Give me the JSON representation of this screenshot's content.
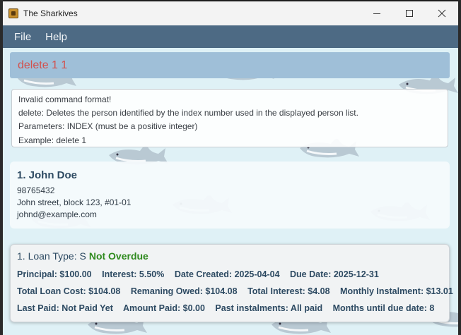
{
  "window": {
    "title": "The Sharkives"
  },
  "menu": {
    "items": [
      "File",
      "Help"
    ]
  },
  "command": {
    "text": "delete 1 1"
  },
  "result": {
    "lines": [
      "Invalid command format!",
      "delete: Deletes the person identified by the index number used in the displayed person list.",
      "Parameters: INDEX (must be a positive integer)",
      "Example: delete 1"
    ]
  },
  "person": {
    "index_name": "1.  John Doe",
    "phone": "98765432",
    "address": "John street, block 123, #01-01",
    "email": "johnd@example.com"
  },
  "loan": {
    "title": "1. Loan Type: S",
    "status": "Not Overdue",
    "row1": [
      "Principal: $100.00",
      "Interest: 5.50%",
      "Date Created: 2025-04-04",
      "Due Date: 2025-12-31"
    ],
    "row2": [
      "Total Loan Cost: $104.08",
      "Remaning Owed: $104.08",
      "Total Interest: $4.08",
      "Monthly Instalment: $13.01"
    ],
    "row3": [
      "Last Paid: Not Paid Yet",
      "Amount Paid: $0.00",
      "Past instalments: All paid",
      "Months until due date: 8"
    ]
  },
  "colors": {
    "menubar": "#4d6a84",
    "command_bar": "#9fbfd8",
    "command_text": "#d2514d",
    "status_ok": "#2f8a1e",
    "background": "#dff1f6"
  }
}
